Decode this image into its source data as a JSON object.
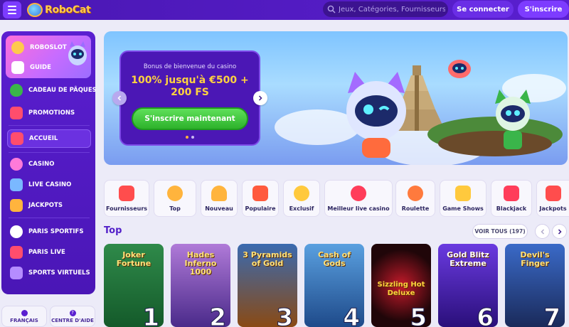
{
  "header": {
    "logo_text": "RoboCat",
    "search_placeholder": "Jeux, Catégories, Fournisseurs",
    "login_label": "Se connecter",
    "signup_label": "S'inscrire"
  },
  "sidebar": {
    "promo": [
      {
        "label": "ROBOSLOT",
        "icon": "coin-icon"
      },
      {
        "label": "GUIDE",
        "icon": "dice-icon"
      }
    ],
    "items": [
      {
        "label": "CADEAU DE PÂQUES",
        "icon": "easter-egg-icon",
        "color": "#3ab54a"
      },
      {
        "label": "PROMOTIONS",
        "icon": "gift-icon",
        "color": "#ff4d6d"
      },
      {
        "label": "ACCUEIL",
        "icon": "home-icon",
        "color": "#ff4d6d",
        "active": true
      },
      {
        "label": "CASINO",
        "icon": "casino-chip-icon",
        "color": "#ff7ad9"
      },
      {
        "label": "LIVE CASINO",
        "icon": "cards-icon",
        "color": "#7ab8ff"
      },
      {
        "label": "JACKPOTS",
        "icon": "jackpot-icon",
        "color": "#ffb43d"
      },
      {
        "label": "PARIS SPORTIFS",
        "icon": "ball-icon",
        "color": "#ffffff"
      },
      {
        "label": "PARIS LIVE",
        "icon": "live-icon",
        "color": "#ff4d6d"
      },
      {
        "label": "SPORTS VIRTUELS",
        "icon": "virtual-sports-icon",
        "color": "#b58cff"
      }
    ],
    "footer": {
      "language_label": "FRANÇAIS",
      "help_label": "CENTRE D'AIDE"
    }
  },
  "banner": {
    "subtitle": "Bonus de bienvenue du casino",
    "title": "100% jusqu'à €500 + 200 FS",
    "cta": "S'inscrire maintenant",
    "slides": 2,
    "current_slide": 1
  },
  "categories": [
    {
      "label": "Fournisseurs",
      "icon": "providers-icon",
      "color": "#ff4d4d"
    },
    {
      "label": "Top",
      "icon": "medal-icon",
      "color": "#ffb43d"
    },
    {
      "label": "Nouveau",
      "icon": "bell-icon",
      "color": "#ffb43d"
    },
    {
      "label": "Populaire",
      "icon": "star-icon",
      "color": "#ff5a3d"
    },
    {
      "label": "Exclusif",
      "icon": "coin-icon",
      "color": "#ffc93d"
    },
    {
      "label": "Meilleur live casino",
      "icon": "roulette-chip-icon",
      "color": "#ff3d5a"
    },
    {
      "label": "Roulette",
      "icon": "roulette-icon",
      "color": "#ff7a3d"
    },
    {
      "label": "Game Shows",
      "icon": "game-shows-icon",
      "color": "#ffc93d"
    },
    {
      "label": "Blackjack",
      "icon": "blackjack-icon",
      "color": "#ff3d5a"
    },
    {
      "label": "Jackpots",
      "icon": "sevens-icon",
      "color": "#ff4d4d"
    }
  ],
  "top_section": {
    "title": "Top",
    "view_all": "VOIR TOUS (197)",
    "games": [
      {
        "name": "Joker Fortune",
        "rank": "1",
        "bg": "#1f6b3a"
      },
      {
        "name": "Hades Inferno 1000",
        "rank": "2",
        "bg": "#5b3aa8"
      },
      {
        "name": "3 Pyramids of Gold",
        "rank": "3",
        "bg": "#7a3a14"
      },
      {
        "name": "Cash of Gods",
        "rank": "4",
        "bg": "#2b5fb0"
      },
      {
        "name": "Sizzling Hot Deluxe",
        "rank": "5",
        "bg": "#2a0b10"
      },
      {
        "name": "Gold Blitz Extreme",
        "rank": "6",
        "bg": "#4a1fb0"
      },
      {
        "name": "Devil's Finger",
        "rank": "7",
        "bg": "#2a4a8a"
      }
    ]
  }
}
